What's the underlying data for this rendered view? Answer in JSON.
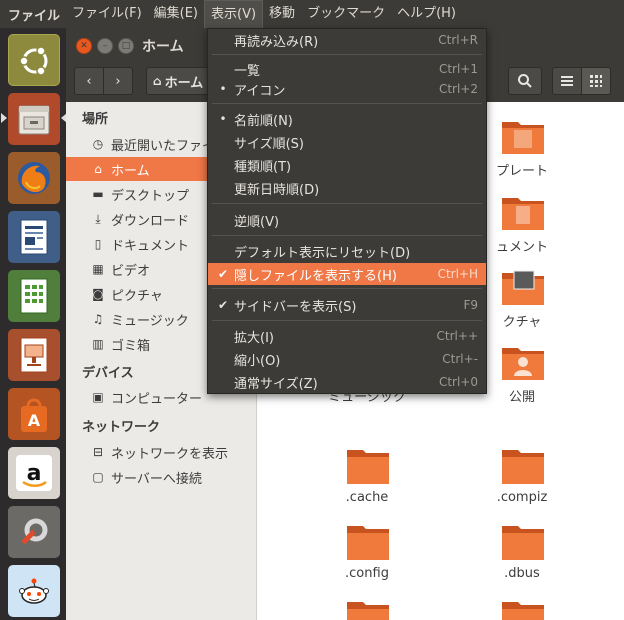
{
  "topbar": {
    "app_title": "ファイル",
    "menus": [
      "ファイル(F)",
      "編集(E)",
      "表示(V)",
      "移動",
      "ブックマーク",
      "ヘルプ(H)"
    ],
    "active_menu": "表示(V)"
  },
  "launcher": {
    "items": [
      "ubuntu-dash",
      "files",
      "firefox",
      "libreoffice-writer",
      "libreoffice-calc",
      "libreoffice-impress",
      "ubuntu-software-center",
      "amazon",
      "system-settings",
      "reddit"
    ]
  },
  "window": {
    "title": "ホーム",
    "path_label": "ホーム"
  },
  "sidebar": {
    "places_header": "場所",
    "places": [
      {
        "label": "最近開いたファイル",
        "icon": "clock-icon"
      },
      {
        "label": "ホーム",
        "icon": "home-icon"
      },
      {
        "label": "デスクトップ",
        "icon": "folder-icon"
      },
      {
        "label": "ダウンロード",
        "icon": "download-icon"
      },
      {
        "label": "ドキュメント",
        "icon": "document-icon"
      },
      {
        "label": "ビデオ",
        "icon": "video-icon"
      },
      {
        "label": "ピクチャ",
        "icon": "camera-icon"
      },
      {
        "label": "ミュージック",
        "icon": "music-icon"
      },
      {
        "label": "ゴミ箱",
        "icon": "trash-icon"
      }
    ],
    "devices_header": "デバイス",
    "devices": [
      {
        "label": "コンピューター",
        "icon": "computer-icon"
      }
    ],
    "network_header": "ネットワーク",
    "network": [
      {
        "label": "ネットワークを表示",
        "icon": "network-icon"
      },
      {
        "label": "サーバーへ接続",
        "icon": "server-icon"
      }
    ]
  },
  "content": {
    "folders": [
      {
        "label": "プレート"
      },
      {
        "label": "ュメント"
      },
      {
        "label": "クチャ"
      },
      {
        "label": "公開"
      },
      {
        "label": "ミュージック"
      },
      {
        "label": ".cache"
      },
      {
        "label": ".compiz"
      },
      {
        "label": ".config"
      },
      {
        "label": ".dbus"
      }
    ]
  },
  "view_menu": {
    "items": [
      {
        "label": "再読み込み(R)",
        "accel": "Ctrl+R"
      },
      {
        "label": "一覧",
        "accel": "Ctrl+1"
      },
      {
        "label": "アイコン",
        "accel": "Ctrl+2",
        "mark": "•"
      },
      {
        "label": "名前順(N)",
        "mark": "•"
      },
      {
        "label": "サイズ順(S)"
      },
      {
        "label": "種類順(T)"
      },
      {
        "label": "更新日時順(D)"
      },
      {
        "label": "逆順(V)"
      },
      {
        "label": "デフォルト表示にリセット(D)"
      },
      {
        "label": "隠しファイルを表示する(H)",
        "accel": "Ctrl+H",
        "mark": "✔"
      },
      {
        "label": "サイドバーを表示(S)",
        "accel": "F9",
        "mark": "✔"
      },
      {
        "label": "拡大(I)",
        "accel": "Ctrl++"
      },
      {
        "label": "縮小(O)",
        "accel": "Ctrl+-"
      },
      {
        "label": "通常サイズ(Z)",
        "accel": "Ctrl+0"
      }
    ]
  },
  "colors": {
    "accent": "#f07746",
    "panel": "#3c3b37",
    "launcher": "#2e2b2d"
  }
}
